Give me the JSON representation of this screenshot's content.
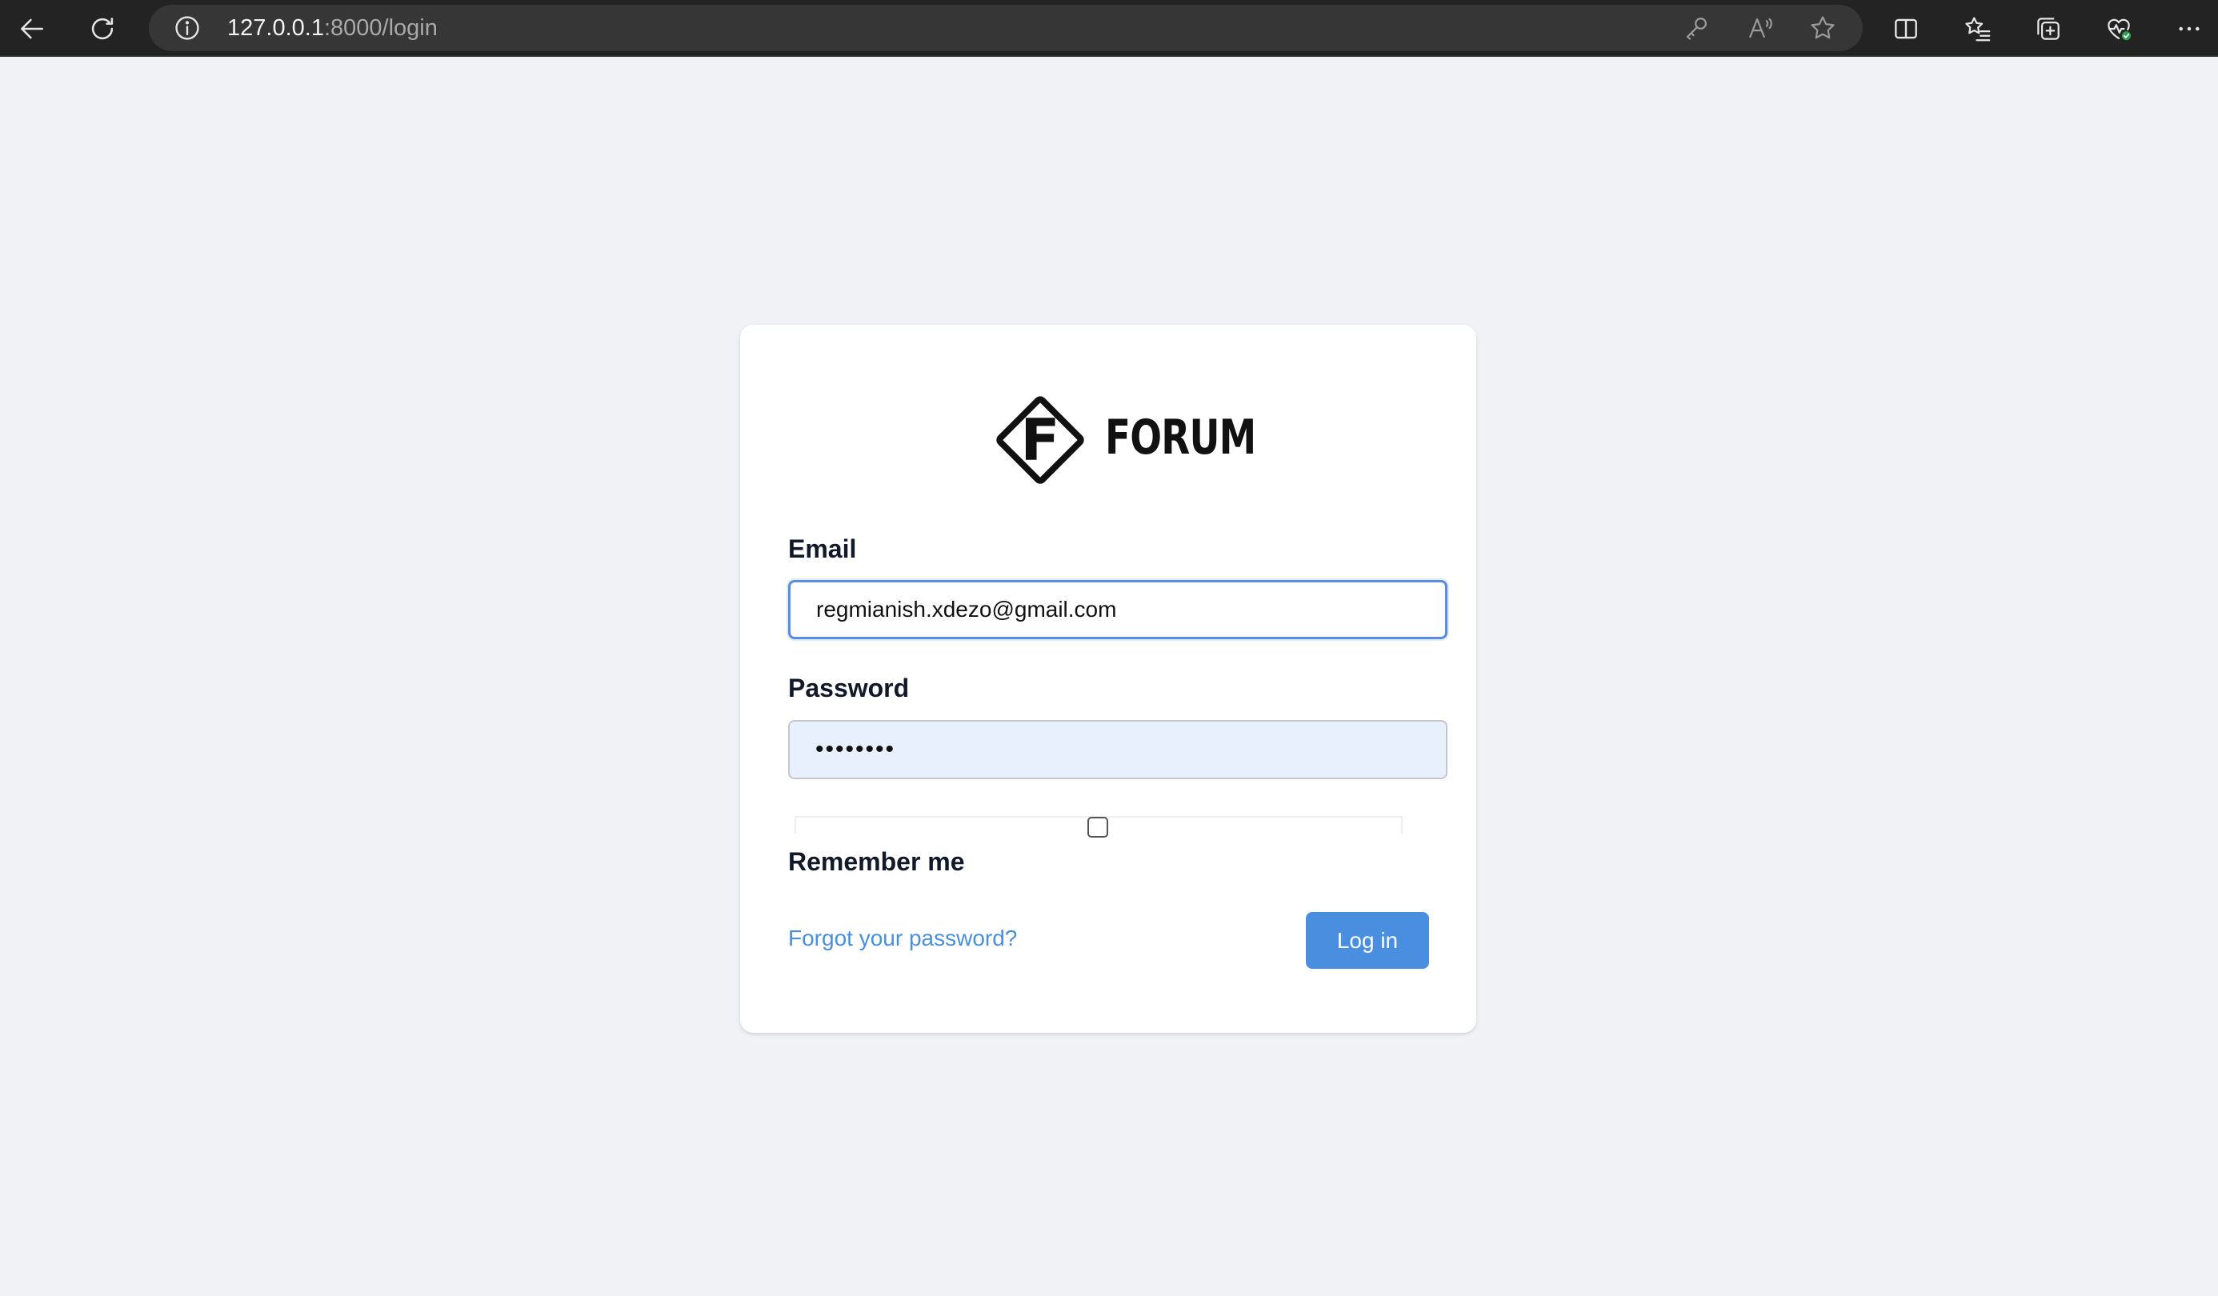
{
  "browser": {
    "url_host": "127.0.0.1",
    "url_rest": ":8000/login",
    "icons": [
      "back-icon",
      "refresh-icon",
      "info-icon",
      "password-key-icon",
      "read-aloud-icon",
      "favorite-star-icon",
      "split-screen-icon",
      "favorites-list-icon",
      "collections-icon",
      "browser-essentials-icon",
      "more-icon"
    ]
  },
  "logo": {
    "mark_letter": "F",
    "wordmark": "FORUM"
  },
  "form": {
    "email_label": "Email",
    "email_value": "regmianish.xdezo@gmail.com",
    "password_label": "Password",
    "password_value": "••••••••",
    "remember_label": "Remember me",
    "remember_checked": false,
    "forgot_link": "Forgot your password?",
    "login_button": "Log in"
  },
  "colors": {
    "accent": "#4a8fdf",
    "page_bg": "#f1f2f5",
    "autofill_bg": "#e8f0fe",
    "toolbar_bg": "#232323"
  }
}
